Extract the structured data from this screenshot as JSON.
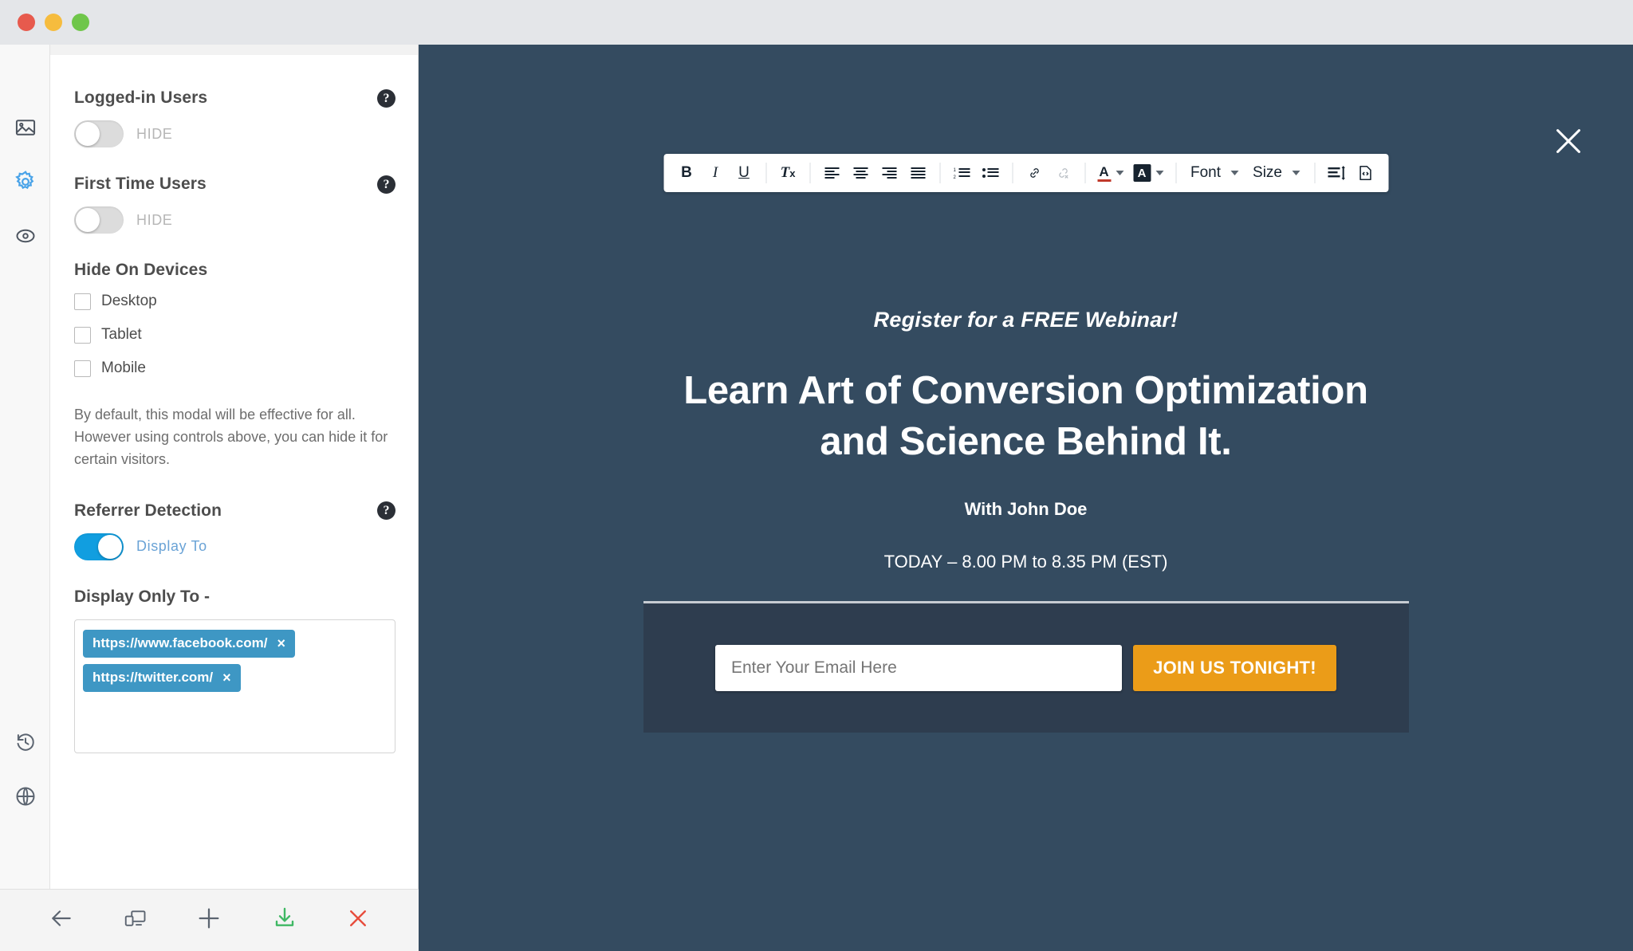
{
  "window": {
    "traffic_lights": [
      "close",
      "minimize",
      "maximize"
    ]
  },
  "rail": {
    "top_items": [
      {
        "name": "image-icon",
        "label": "Image",
        "active": false
      },
      {
        "name": "gear-icon",
        "label": "Settings",
        "active": true
      },
      {
        "name": "target-icon",
        "label": "Targeting",
        "active": false
      }
    ],
    "bottom_items": [
      {
        "name": "history-icon",
        "label": "History"
      },
      {
        "name": "globe-icon",
        "label": "Global"
      }
    ]
  },
  "panel": {
    "logged_in_users": {
      "label": "Logged-in Users",
      "toggle_text": "HIDE",
      "toggle_on": false,
      "help": "?"
    },
    "first_time_users": {
      "label": "First Time Users",
      "toggle_text": "HIDE",
      "toggle_on": false,
      "help": "?"
    },
    "hide_on_devices": {
      "label": "Hide On Devices",
      "options": [
        {
          "label": "Desktop",
          "checked": false
        },
        {
          "label": "Tablet",
          "checked": false
        },
        {
          "label": "Mobile",
          "checked": false
        }
      ]
    },
    "note": "By default, this modal will be effective for all. However using controls above, you can hide it for certain visitors.",
    "referrer_detection": {
      "label": "Referrer Detection",
      "toggle_text": "Display To",
      "toggle_on": true,
      "help": "?"
    },
    "display_only_to": {
      "label": "Display Only To -",
      "tags": [
        {
          "text": "https://www.facebook.com/",
          "remove": "×"
        },
        {
          "text": "https://twitter.com/",
          "remove": "×"
        }
      ]
    }
  },
  "bottom_toolbar": {
    "items": [
      {
        "name": "back-arrow-icon",
        "label": "Back"
      },
      {
        "name": "devices-icon",
        "label": "Responsive Preview"
      },
      {
        "name": "plus-icon",
        "label": "Add"
      },
      {
        "name": "download-icon",
        "label": "Save"
      },
      {
        "name": "close-x-icon",
        "label": "Delete"
      }
    ]
  },
  "editor_toolbar": {
    "bold": "B",
    "italic": "I",
    "underline": "U",
    "remove_format": "Tx",
    "align_left": "align-left",
    "align_center": "align-center",
    "align_right": "align-right",
    "align_justify": "align-justify",
    "ordered_list": "ordered-list",
    "unordered_list": "unordered-list",
    "link": "link",
    "unlink": "unlink",
    "text_color": "A",
    "background_color": "A",
    "font_label": "Font",
    "size_label": "Size",
    "line_height": "line-height",
    "source_code": "source-code"
  },
  "modal_preview": {
    "close_label": "×",
    "kicker": "Register for a FREE Webinar!",
    "headline_line1": "Learn Art of Conversion Optimization",
    "headline_line2": "and Science Behind It.",
    "presenter": "With John Doe",
    "schedule": "TODAY – 8.00 PM to 8.35 PM (EST)",
    "email_placeholder": "Enter Your Email Here",
    "email_value": "",
    "cta_button": "JOIN US TONIGHT!"
  },
  "colors": {
    "modal_background": "#344b60",
    "cta_background": "#2e3d4f",
    "cta_button": "#eb9c18",
    "toggle_on": "#119ee0",
    "tag": "#3e97c4",
    "accent_icon": "#4aa3e8",
    "download_green": "#3fb864",
    "delete_red": "#e74c3c"
  }
}
